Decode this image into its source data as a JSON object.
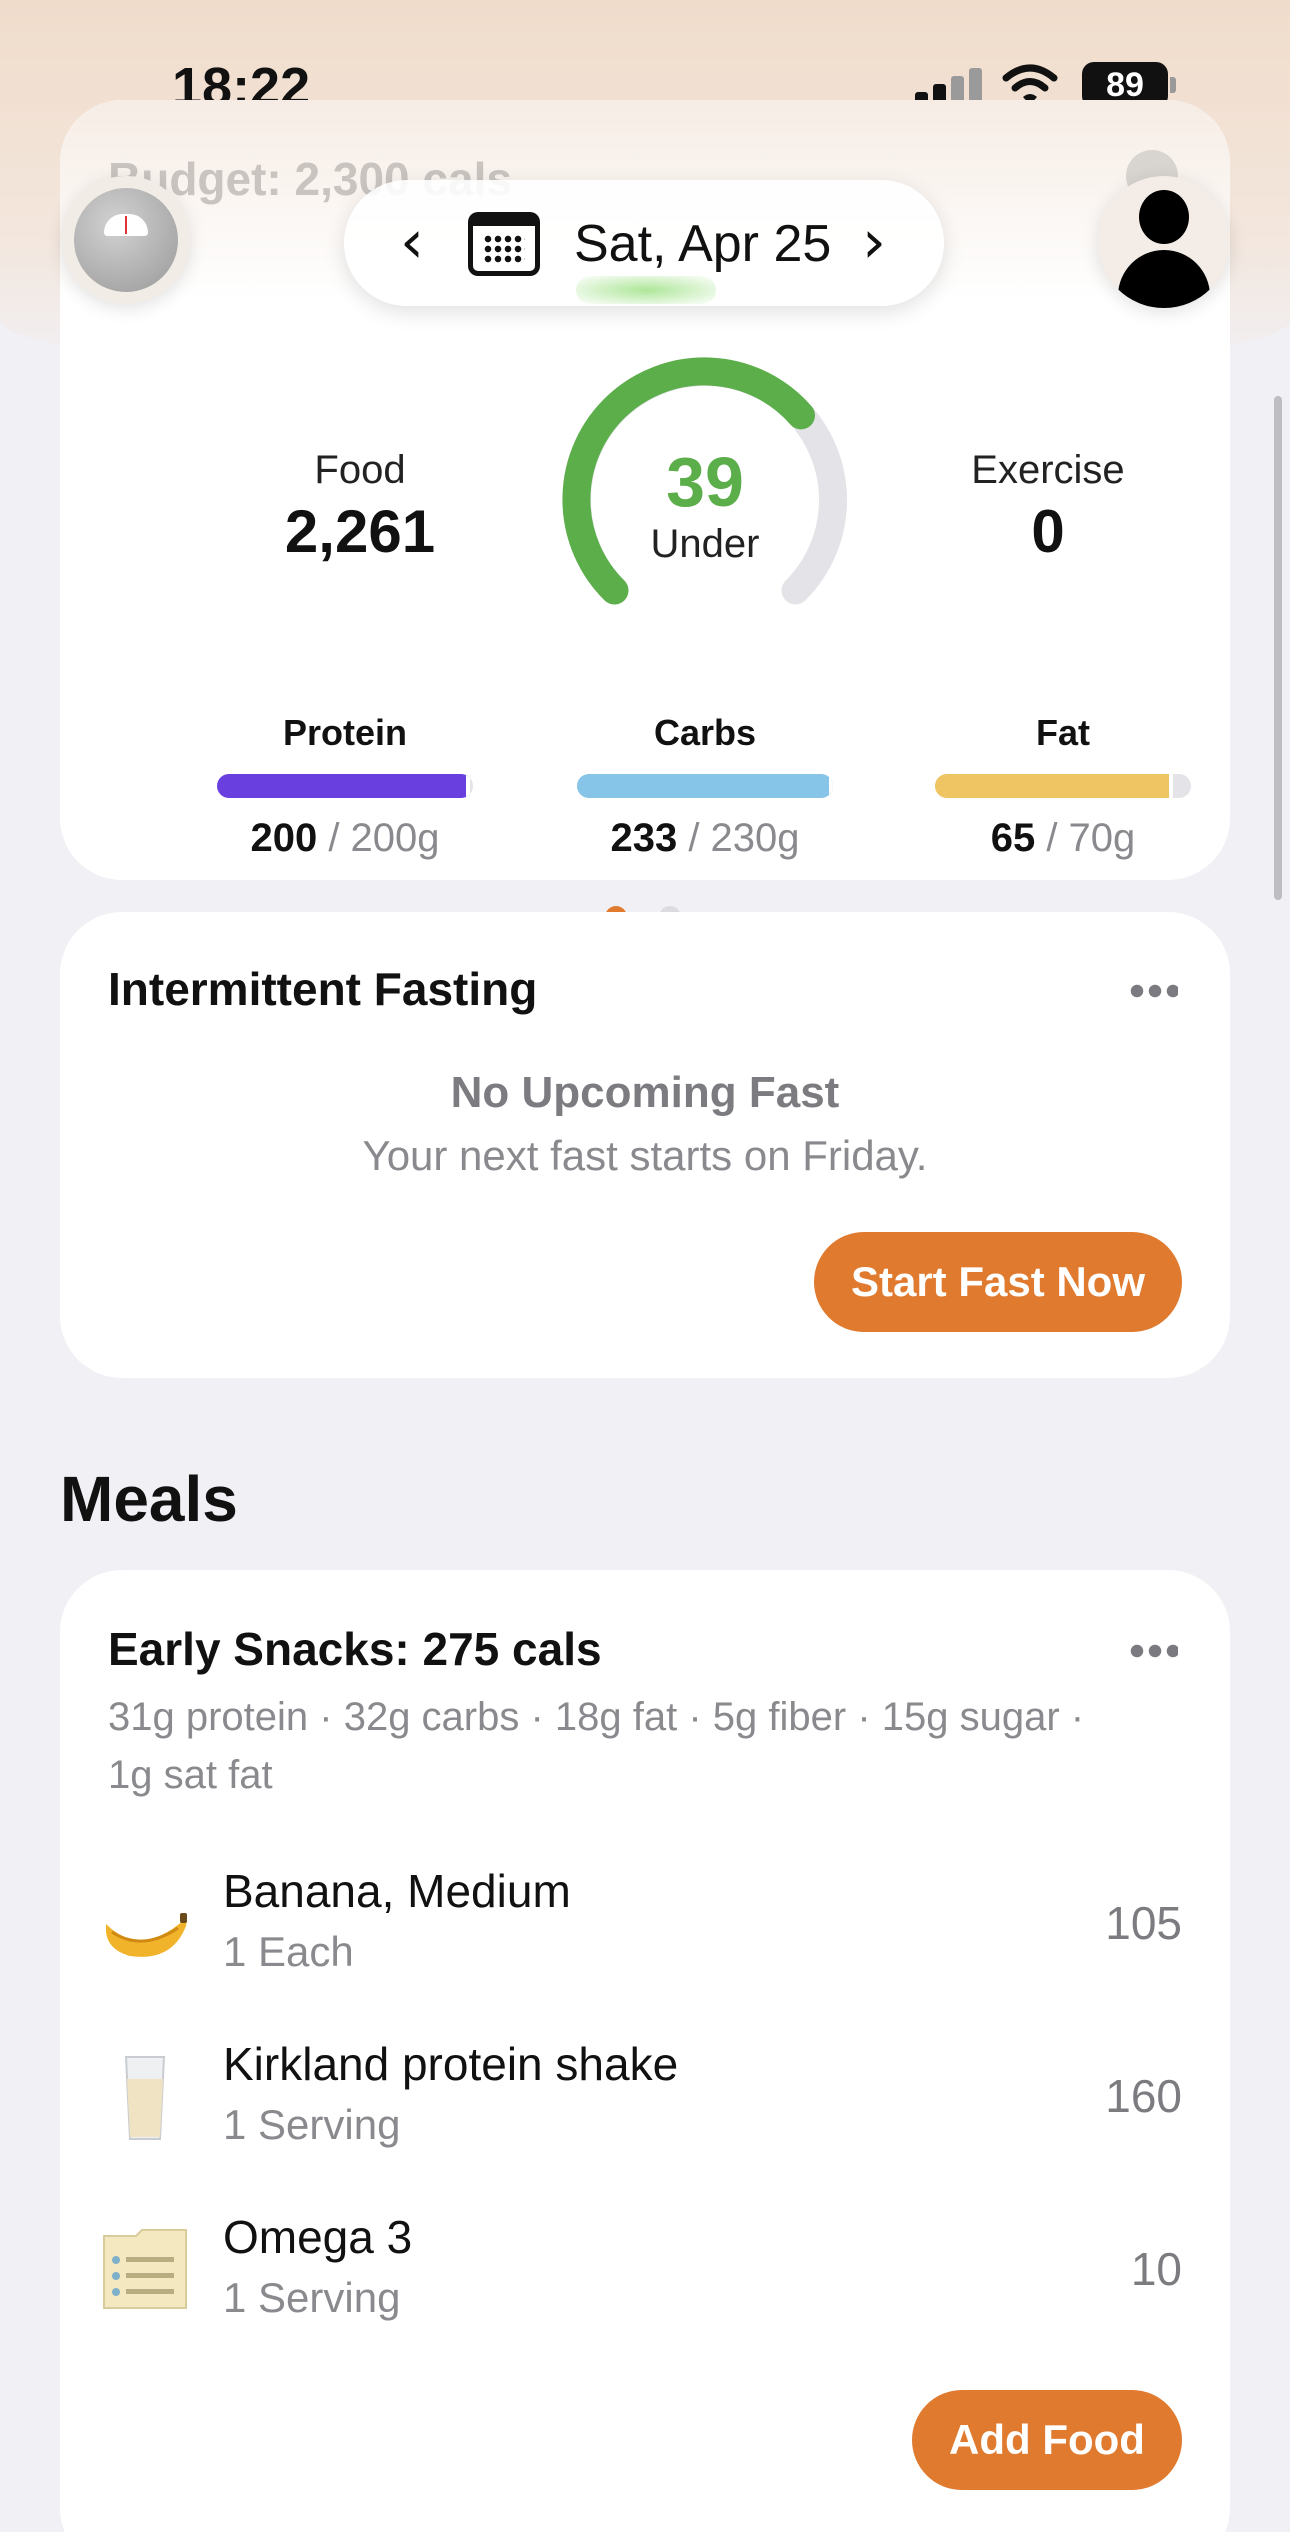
{
  "status_bar": {
    "time": "18:22",
    "battery": "89"
  },
  "header": {
    "budget_text": "Budget: 2,300 cals",
    "date": "Sat, Apr 25",
    "prev_symbol": "‹",
    "next_symbol": "›"
  },
  "summary": {
    "food_label": "Food",
    "food_value": "2,261",
    "exercise_label": "Exercise",
    "exercise_value": "0",
    "remaining_value": "39",
    "remaining_label": "Under",
    "gauge_fraction": 0.98,
    "colors": {
      "gauge": "#5bae4a",
      "gauge_track": "#e4e4e8"
    }
  },
  "macros": [
    {
      "name": "Protein",
      "consumed": "200",
      "goal": "/ 200g",
      "fraction": 0.99,
      "color": "#6a3fe0"
    },
    {
      "name": "Carbs",
      "consumed": "233",
      "goal": "/ 230g",
      "fraction": 1.0,
      "color": "#86c4e8"
    },
    {
      "name": "Fat",
      "consumed": "65",
      "goal": "/ 70g",
      "fraction": 0.93,
      "color": "#efc463"
    }
  ],
  "pager": {
    "active_index": 0,
    "count": 2,
    "active_color": "#e07a2f",
    "inactive_color": "#dcdce0"
  },
  "fasting": {
    "title": "Intermittent Fasting",
    "status_title": "No Upcoming Fast",
    "status_sub": "Your next fast starts on Friday.",
    "button": "Start Fast Now"
  },
  "meals": {
    "heading": "Meals",
    "group_title": "Early Snacks: 275 cals",
    "group_macros": "31g protein · 32g carbs · 18g fat · 5g fiber · 15g sugar · 1g sat fat",
    "items": [
      {
        "name": "Banana, Medium",
        "serving": "1 Each",
        "cals": "105",
        "icon": "banana-icon"
      },
      {
        "name": "Kirkland protein shake",
        "serving": "1 Serving",
        "cals": "160",
        "icon": "glass-icon"
      },
      {
        "name": "Omega 3",
        "serving": "1 Serving",
        "cals": "10",
        "icon": "note-icon"
      }
    ],
    "add_button": "Add Food"
  },
  "accent_color": "#e07a2f"
}
